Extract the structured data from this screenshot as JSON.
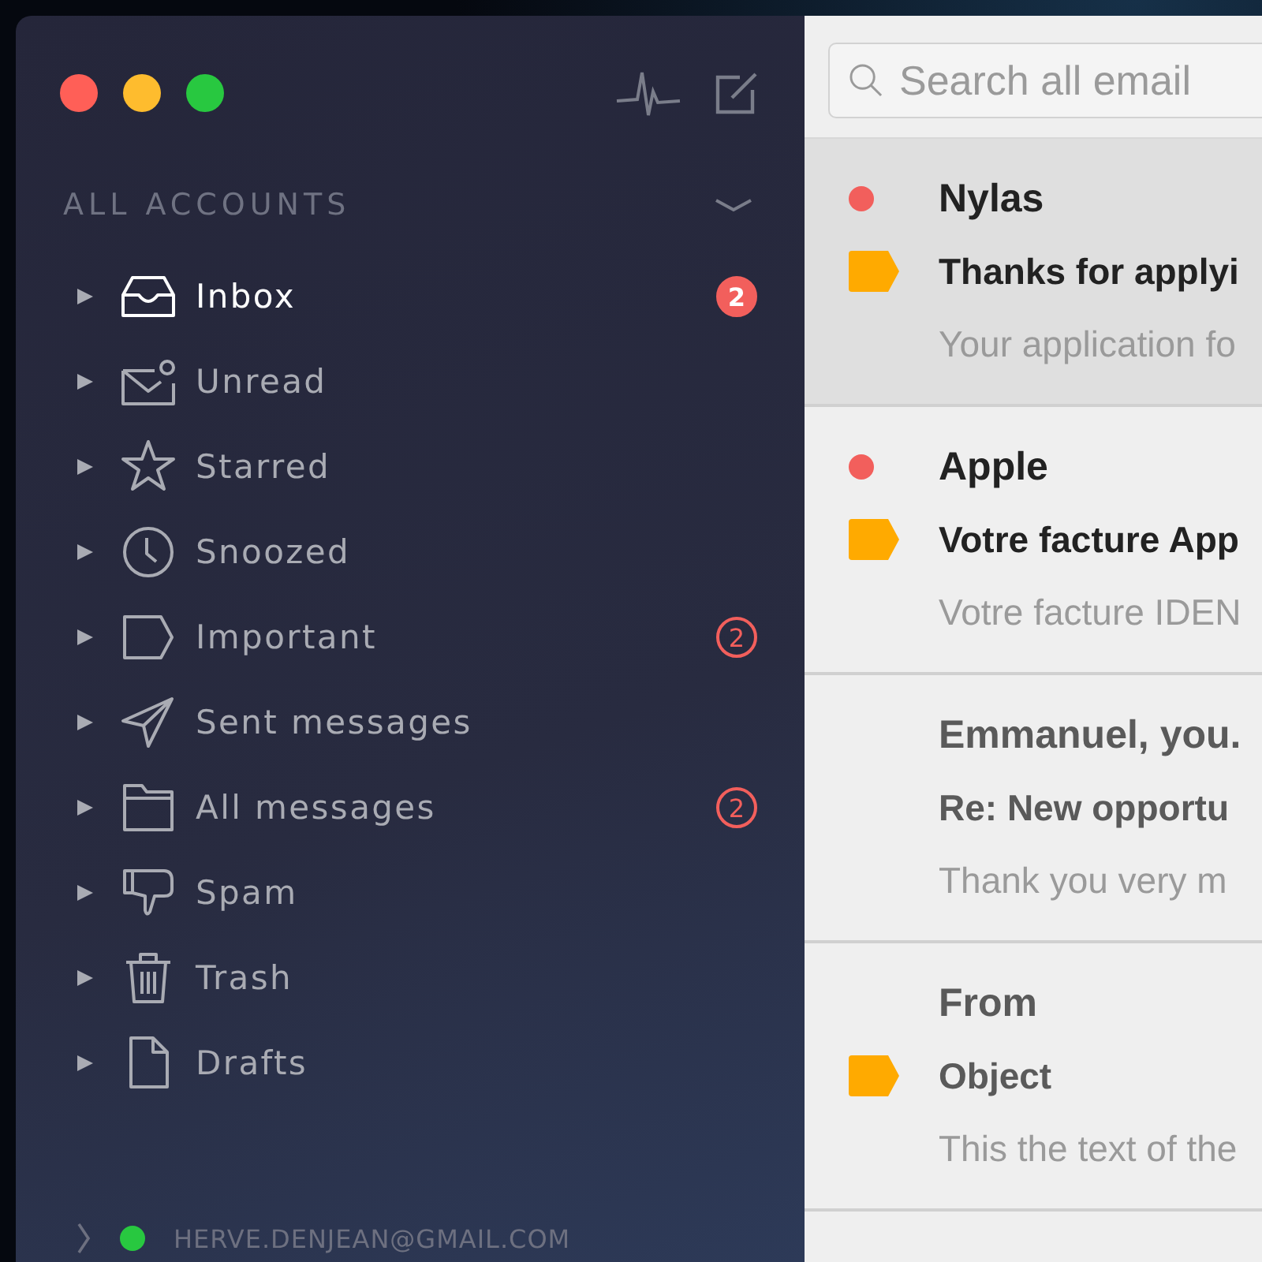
{
  "sidebar": {
    "section_title": "ALL ACCOUNTS",
    "expanded": true,
    "items": [
      {
        "label": "Inbox",
        "selected": true,
        "badge": "2"
      },
      {
        "label": "Unread",
        "selected": false
      },
      {
        "label": "Starred",
        "selected": false
      },
      {
        "label": "Snoozed",
        "selected": false
      },
      {
        "label": "Important",
        "selected": false,
        "badge": "2"
      },
      {
        "label": "Sent messages",
        "selected": false
      },
      {
        "label": "All messages",
        "selected": false,
        "badge": "2"
      },
      {
        "label": "Spam",
        "selected": false
      },
      {
        "label": "Trash",
        "selected": false
      },
      {
        "label": "Drafts",
        "selected": false
      }
    ],
    "account": {
      "email": "HERVE.DENJEAN@GMAIL.COM",
      "online": true
    }
  },
  "search": {
    "placeholder": "Search all email"
  },
  "emails": [
    {
      "sender": "Nylas",
      "subject": "Thanks for applyi",
      "preview": "Your application fo",
      "unread": true,
      "labeled": true,
      "selected": true
    },
    {
      "sender": "Apple",
      "subject": "Votre facture App",
      "preview": "Votre facture IDEN",
      "unread": true,
      "labeled": true,
      "selected": false
    },
    {
      "sender": "Emmanuel, you.",
      "subject": "Re: New opportu",
      "preview": "Thank you very m",
      "unread": false,
      "labeled": false,
      "selected": false
    },
    {
      "sender": "From",
      "subject": "Object",
      "preview": "This the text of the",
      "unread": false,
      "labeled": true,
      "selected": false
    }
  ]
}
